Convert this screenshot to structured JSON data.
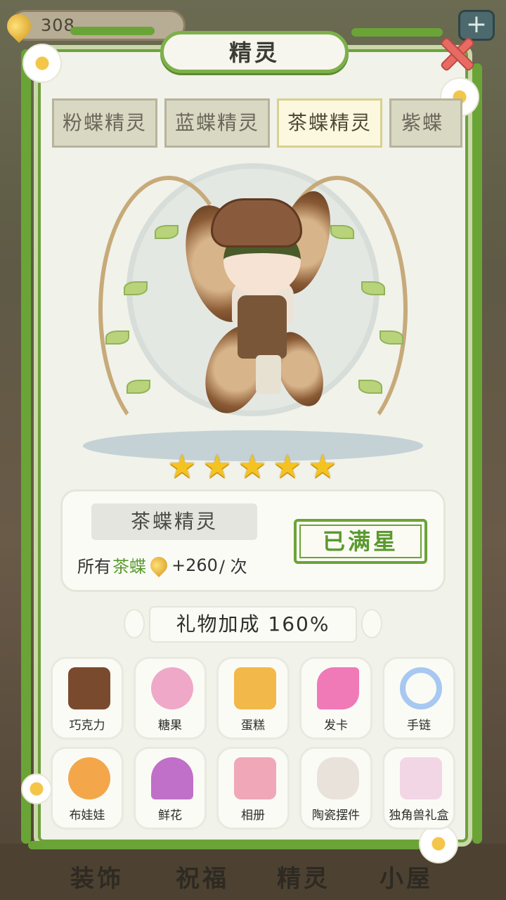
{
  "header": {
    "resource_value": "308",
    "plus_label": "+"
  },
  "panel": {
    "title": "精灵",
    "close_icon": "close-x-icon"
  },
  "tabs": [
    {
      "label": "粉蝶精灵",
      "active": false
    },
    {
      "label": "蓝蝶精灵",
      "active": false
    },
    {
      "label": "茶蝶精灵",
      "active": true
    },
    {
      "label": "紫蝶精",
      "active": false
    }
  ],
  "fairy": {
    "name": "茶蝶精灵",
    "stars": 5,
    "max_stars": 5,
    "bonus_prefix": "所有",
    "bonus_highlight": "茶蝶",
    "bonus_value": "+260",
    "bonus_suffix": " / 次",
    "status_button": "已满星"
  },
  "gift_bonus": {
    "label": "礼物加成 160%"
  },
  "gifts": [
    {
      "label": "巧克力",
      "icon": "chocolate-icon",
      "color": "#7a4a2e"
    },
    {
      "label": "糖果",
      "icon": "candy-jar-icon",
      "color": "#f0a8c8"
    },
    {
      "label": "蛋糕",
      "icon": "cake-icon",
      "color": "#f2b84a"
    },
    {
      "label": "发卡",
      "icon": "bow-hairclip-icon",
      "color": "#f07ab8"
    },
    {
      "label": "手链",
      "icon": "bracelet-icon",
      "color": "#a7c8f0"
    },
    {
      "label": "布娃娃",
      "icon": "doll-icon",
      "color": "#f4a64a"
    },
    {
      "label": "鲜花",
      "icon": "bouquet-icon",
      "color": "#c070c8"
    },
    {
      "label": "相册",
      "icon": "photo-album-icon",
      "color": "#f0a8b8"
    },
    {
      "label": "陶瓷摆件",
      "icon": "ceramic-cat-icon",
      "color": "#e8e2da"
    },
    {
      "label": "独角兽礼盒",
      "icon": "unicorn-giftbox-icon",
      "color": "#f3d6e6"
    }
  ],
  "bottom_nav": [
    "装饰",
    "祝福",
    "精灵",
    "小屋"
  ]
}
